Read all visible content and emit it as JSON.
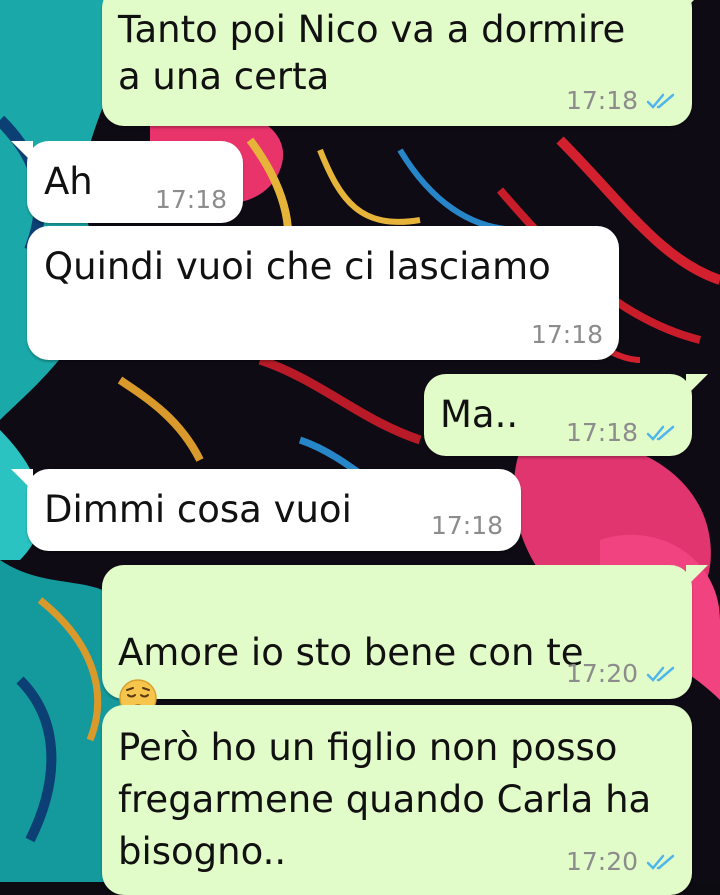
{
  "colors": {
    "incoming_bubble": "#ffffff",
    "outgoing_bubble": "#e2fcc9",
    "read_ticks": "#4fb6ec",
    "timestamp": "#8c8c8c"
  },
  "messages": [
    {
      "direction": "outgoing",
      "text": "Tanto poi Nico va a dormire\na una certa",
      "time": "17:18",
      "status_icon": "double-check-read-icon"
    },
    {
      "direction": "incoming",
      "text": "Ah",
      "time": "17:18"
    },
    {
      "direction": "incoming",
      "text": "Quindi vuoi che ci lasciamo",
      "time": "17:18"
    },
    {
      "direction": "outgoing",
      "text": "Ma..",
      "time": "17:18",
      "status_icon": "double-check-read-icon"
    },
    {
      "direction": "incoming",
      "text": "Dimmi cosa vuoi",
      "time": "17:18"
    },
    {
      "direction": "outgoing",
      "text": "Amore io sto bene con te",
      "emoji": "pensive-face-icon",
      "time": "17:20",
      "status_icon": "double-check-read-icon"
    },
    {
      "direction": "outgoing",
      "text": "Però ho un figlio non posso\nfregarmene quando Carla ha\nbisogno..",
      "time": "17:20",
      "status_icon": "double-check-read-icon"
    }
  ]
}
